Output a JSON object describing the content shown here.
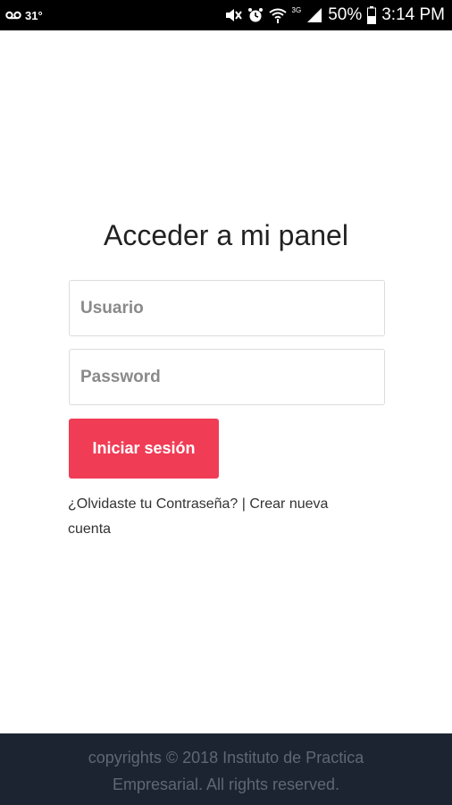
{
  "status_bar": {
    "temperature": "31°",
    "network_label": "3G",
    "battery": "50%",
    "time": "3:14 PM",
    "icons": [
      "voicemail-icon",
      "mute-icon",
      "alarm-icon",
      "wifi-icon",
      "signal-icon",
      "battery-icon"
    ]
  },
  "login": {
    "title": "Acceder a mi panel",
    "username_placeholder": "Usuario",
    "password_placeholder": "Password",
    "submit_label": "Iniciar sesión",
    "forgot_link": "¿Olvidaste tu Contraseña?",
    "separator": " | ",
    "create_link": "Crear nueva cuenta"
  },
  "footer": {
    "line1": "copyrights © 2018 Instituto de Practica",
    "line2": "Empresarial.   All rights reserved."
  },
  "colors": {
    "accent": "#f03c55",
    "footer_bg": "#1c2431",
    "footer_text": "#5f6775"
  }
}
